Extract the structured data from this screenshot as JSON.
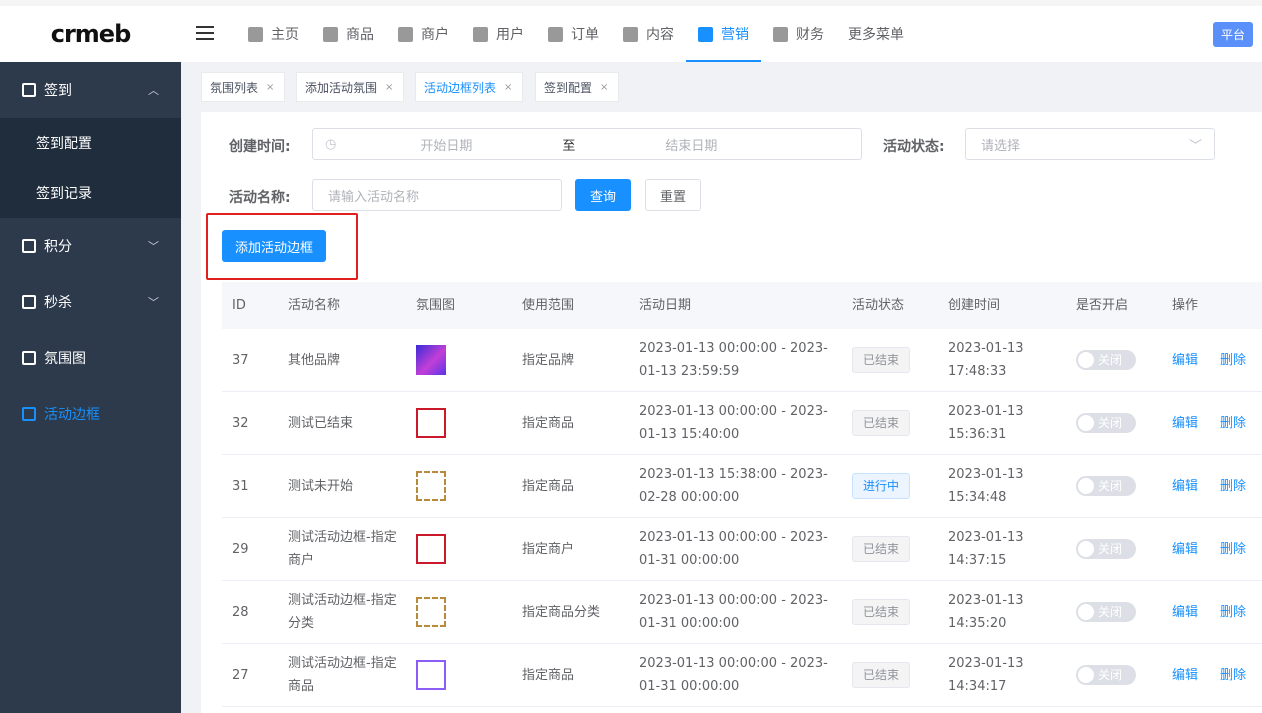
{
  "logo": "crmeb",
  "platform_label": "平台",
  "nav": [
    {
      "label": "主页",
      "icon": "grid-icon"
    },
    {
      "label": "商品",
      "icon": "bag-icon"
    },
    {
      "label": "商户",
      "icon": "store-icon"
    },
    {
      "label": "用户",
      "icon": "user-icon"
    },
    {
      "label": "订单",
      "icon": "clipboard-icon"
    },
    {
      "label": "内容",
      "icon": "book-icon"
    },
    {
      "label": "营销",
      "icon": "chart-icon",
      "active": true
    },
    {
      "label": "财务",
      "icon": "wallet-icon"
    },
    {
      "label": "更多菜单"
    }
  ],
  "sidebar": {
    "signin": "签到",
    "signin_config": "签到配置",
    "signin_record": "签到记录",
    "points": "积分",
    "seckill": "秒杀",
    "atmosphere": "氛围图",
    "activity_border": "活动边框"
  },
  "tags": [
    {
      "label": "氛围列表"
    },
    {
      "label": "添加活动氛围"
    },
    {
      "label": "活动边框列表",
      "active": true
    },
    {
      "label": "签到配置"
    }
  ],
  "filters": {
    "created_label": "创建时间:",
    "start_placeholder": "开始日期",
    "to": "至",
    "end_placeholder": "结束日期",
    "status_label": "活动状态:",
    "status_placeholder": "请选择",
    "name_label": "活动名称:",
    "name_placeholder": "请输入活动名称",
    "query_button": "查询",
    "reset_button": "重置"
  },
  "add_button": "添加活动边框",
  "table": {
    "headers": [
      "ID",
      "活动名称",
      "氛围图",
      "使用范围",
      "活动日期",
      "活动状态",
      "创建时间",
      "是否开启",
      "操作"
    ],
    "edit_label": "编辑",
    "delete_label": "删除",
    "toggle_label": "关闭",
    "rows": [
      {
        "id": "37",
        "name": "其他品牌",
        "thumb": "t-grad",
        "scope": "指定品牌",
        "date": "2023-01-13 00:00:00 - 2023-01-13 23:59:59",
        "status": "已结束",
        "created": "2023-01-13 17:48:33"
      },
      {
        "id": "32",
        "name": "测试已结束",
        "thumb": "t-red",
        "scope": "指定商品",
        "date": "2023-01-13 00:00:00 - 2023-01-13 15:40:00",
        "status": "已结束",
        "created": "2023-01-13 15:36:31"
      },
      {
        "id": "31",
        "name": "测试未开始",
        "thumb": "t-gold",
        "scope": "指定商品",
        "date": "2023-01-13 15:38:00 - 2023-02-28 00:00:00",
        "status": "进行中",
        "created": "2023-01-13 15:34:48"
      },
      {
        "id": "29",
        "name": "测试活动边框-指定商户",
        "thumb": "t-red",
        "scope": "指定商户",
        "date": "2023-01-13 00:00:00 - 2023-01-31 00:00:00",
        "status": "已结束",
        "created": "2023-01-13 14:37:15"
      },
      {
        "id": "28",
        "name": "测试活动边框-指定分类",
        "thumb": "t-gold",
        "scope": "指定商品分类",
        "date": "2023-01-13 00:00:00 - 2023-01-31 00:00:00",
        "status": "已结束",
        "created": "2023-01-13 14:35:20"
      },
      {
        "id": "27",
        "name": "测试活动边框-指定商品",
        "thumb": "t-purple",
        "scope": "指定商品",
        "date": "2023-01-13 00:00:00 - 2023-01-31 00:00:00",
        "status": "已结束",
        "created": "2023-01-13 14:34:17"
      }
    ]
  }
}
